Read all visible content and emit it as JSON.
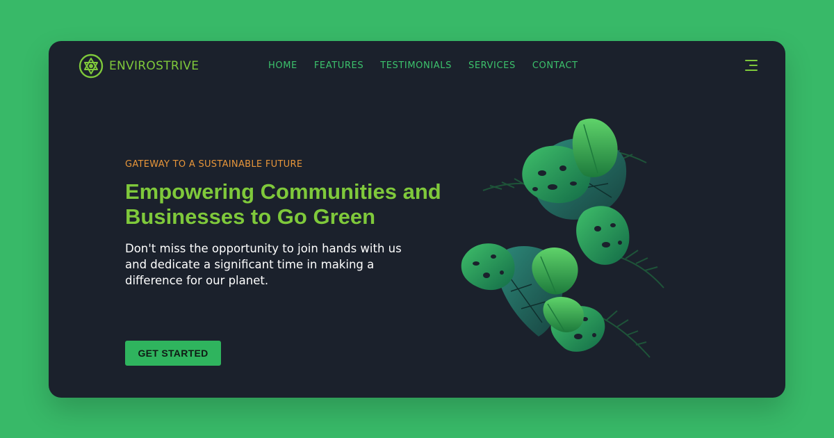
{
  "brand": {
    "name": "ENVIROSTRIVE",
    "logo_icon": "recycle-leaf-logo-icon"
  },
  "nav": {
    "items": [
      {
        "label": "HOME"
      },
      {
        "label": "FEATURES"
      },
      {
        "label": "TESTIMONIALS"
      },
      {
        "label": "SERVICES"
      },
      {
        "label": "CONTACT"
      }
    ],
    "menu_icon": "hamburger-menu-icon"
  },
  "hero": {
    "eyebrow": "GATEWAY TO A SUSTAINABLE FUTURE",
    "headline_line1": "Empowering Communities and",
    "headline_line2": "Businesses to Go Green",
    "lead": "Don't miss the opportunity to join hands with us and dedicate a significant time in making a difference for our planet.",
    "cta_label": "GET STARTED"
  },
  "illustration": {
    "icon": "monstera-leaves-illustration"
  },
  "colors": {
    "page_background": "#38b968",
    "card_background": "#1b212c",
    "brand_green": "#7fc93b",
    "nav_green": "#3cc26c",
    "eyebrow_orange": "#e8963a",
    "button_green": "#2fb45e"
  }
}
